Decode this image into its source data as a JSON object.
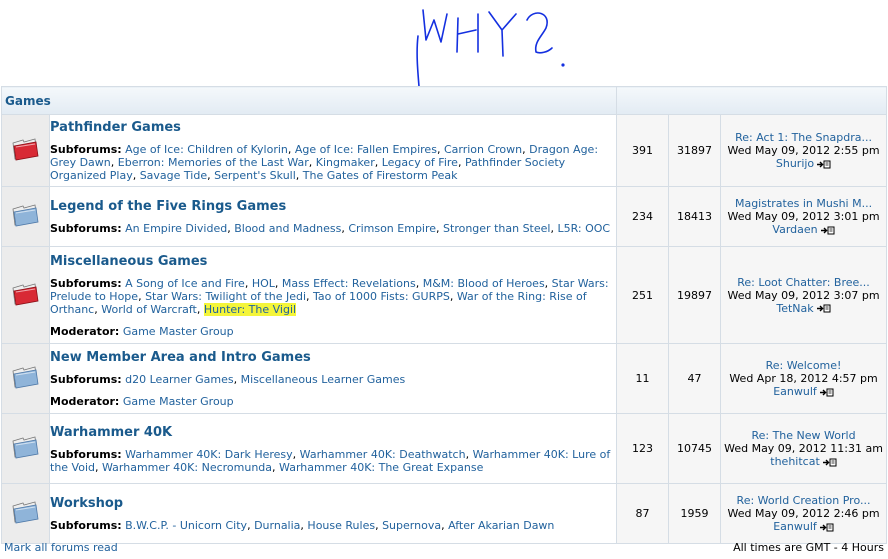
{
  "category": {
    "title": "Games"
  },
  "labels": {
    "subforums": "Subforums:",
    "moderator": "Moderator:"
  },
  "forums": [
    {
      "name": "Pathfinder Games",
      "unread": true,
      "subforums": [
        "Age of Ice: Children of Kylorin",
        "Age of Ice: Fallen Empires",
        "Carrion Crown",
        "Dragon Age: Grey Dawn",
        "Eberron: Memories of the Last War",
        "Kingmaker",
        "Legacy of Fire",
        "Pathfinder Society Organized Play",
        "Savage Tide",
        "Serpent's Skull",
        "The Gates of Firestorm Peak"
      ],
      "moderator": "",
      "topics": "391",
      "posts": "31897",
      "last_title": "Re: Act 1: The Snapdra...",
      "last_date": "Wed May 09, 2012 2:55 pm",
      "last_user": "Shurijo"
    },
    {
      "name": "Legend of the Five Rings Games",
      "unread": false,
      "subforums": [
        "An Empire Divided",
        "Blood and Madness",
        "Crimson Empire",
        "Stronger than Steel",
        "L5R: OOC"
      ],
      "moderator": "",
      "topics": "234",
      "posts": "18413",
      "last_title": "Magistrates in Mushi M...",
      "last_date": "Wed May 09, 2012 3:01 pm",
      "last_user": "Vardaen"
    },
    {
      "name": "Miscellaneous Games",
      "unread": true,
      "subforums": [
        "A Song of Ice and Fire",
        "HOL",
        "Mass Effect: Revelations",
        "M&M: Blood of Heroes",
        "Star Wars: Prelude to Hope",
        "Star Wars: Twilight of the Jedi",
        "Tao of 1000 Fists: GURPS",
        "War of the Ring: Rise of Orthanc",
        "World of Warcraft",
        "Hunter: The Vigil"
      ],
      "highlight_index": 9,
      "moderator": "Game Master Group",
      "topics": "251",
      "posts": "19897",
      "last_title": "Re: Loot Chatter: Bree...",
      "last_date": "Wed May 09, 2012 3:07 pm",
      "last_user": "TetNak"
    },
    {
      "name": "New Member Area and Intro Games",
      "unread": false,
      "subforums": [
        "d20 Learner Games",
        "Miscellaneous Learner Games"
      ],
      "moderator": "Game Master Group",
      "topics": "11",
      "posts": "47",
      "last_title": "Re: Welcome!",
      "last_date": "Wed Apr 18, 2012 4:57 pm",
      "last_user": "Eanwulf"
    },
    {
      "name": "Warhammer 40K",
      "unread": false,
      "subforums": [
        "Warhammer 40K: Dark Heresy",
        "Warhammer 40K: Deathwatch",
        "Warhammer 40K: Lure of the Void",
        "Warhammer 40K: Necromunda",
        "Warhammer 40K: The Great Expanse"
      ],
      "moderator": "",
      "topics": "123",
      "posts": "10745",
      "last_title": "Re: The New World",
      "last_date": "Wed May 09, 2012 11:31 am",
      "last_user": "thehitcat"
    },
    {
      "name": "Workshop",
      "unread": false,
      "subforums": [
        "B.W.C.P. - Unicorn City",
        "Durnalia",
        "House Rules",
        "Supernova",
        "After Akarian Dawn"
      ],
      "moderator": "",
      "topics": "87",
      "posts": "1959",
      "last_title": "Re: World Creation Pro...",
      "last_date": "Wed May 09, 2012 2:46 pm",
      "last_user": "Eanwulf"
    }
  ],
  "footer": {
    "mark_read": "Mark all forums read",
    "timezone": "All times are GMT - 4 Hours"
  },
  "annotation": {
    "text": "WHY?"
  },
  "colors": {
    "link": "#22629d",
    "title": "#1a5a8c",
    "highlight": "#f4f53a",
    "annotation_ink": "#1430e0",
    "unread_folder": "#d82a35",
    "read_folder": "#8fb4d9"
  }
}
